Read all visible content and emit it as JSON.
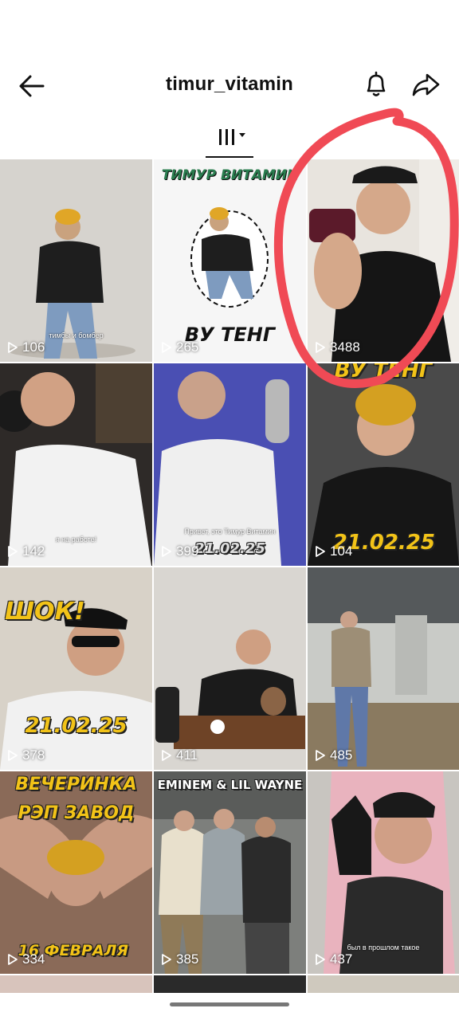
{
  "header": {
    "title": "timur_vitamin",
    "back_icon": "arrow-left-icon",
    "bell_icon": "bell-icon",
    "share_icon": "share-icon"
  },
  "filter": {
    "icon": "grid-columns-icon",
    "dropdown_icon": "caret-down-icon"
  },
  "videos": [
    {
      "views": "106",
      "caption": "тимбы и бомбер"
    },
    {
      "views": "265",
      "overlay_top": "ТИМУР ВИТАМИН",
      "overlay_bottom": "ВУ ТЕНГ"
    },
    {
      "views": "3488"
    },
    {
      "views": "142",
      "caption": "я на работе!"
    },
    {
      "views": "399",
      "caption": "Привет, это Тимур Витамин",
      "overlay_bottom": "21.02.25"
    },
    {
      "views": "104",
      "overlay_top": "ВУ ТЕНГ",
      "overlay_bottom": "21.02.25"
    },
    {
      "views": "378",
      "overlay_top": "ШОК!",
      "overlay_bottom": "21.02.25"
    },
    {
      "views": "411"
    },
    {
      "views": "485"
    },
    {
      "views": "334",
      "overlay_top": "ВЕЧЕРИНКА",
      "overlay_mid": "РЭП ЗАВОД",
      "overlay_bottom": "16 ФЕВРАЛЯ"
    },
    {
      "views": "385",
      "overlay_top": "EMINEM & LIL WAYNE"
    },
    {
      "views": "437",
      "caption": "был в прошлом такое"
    }
  ],
  "colors": {
    "annotation_circle": "#f04a55",
    "overlay_yellow": "#f2c318"
  }
}
